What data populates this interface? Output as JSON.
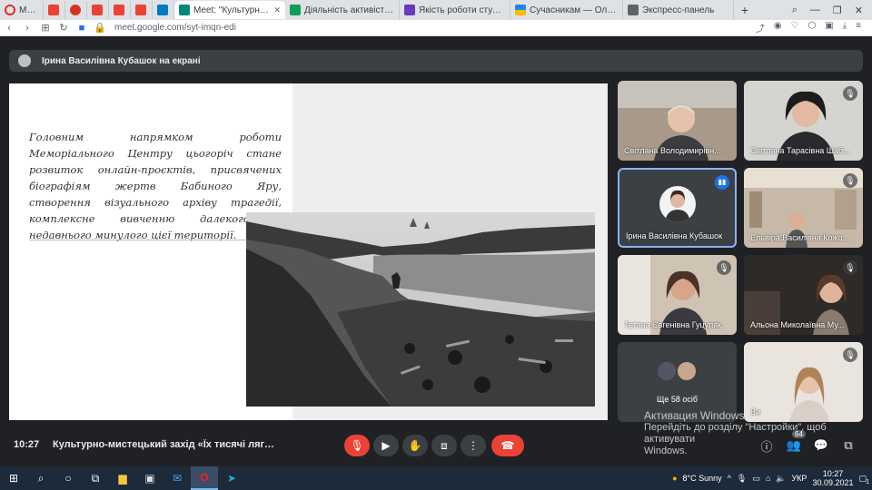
{
  "browser": {
    "tabs": [
      {
        "label": "Меню",
        "color": "#d93025",
        "active": false
      },
      {
        "label": "",
        "color": "#ea4335",
        "active": false
      },
      {
        "label": "",
        "color": "#d93025",
        "active": false
      },
      {
        "label": "",
        "color": "#ea4335",
        "active": false
      },
      {
        "label": "",
        "color": "#ea4335",
        "active": false
      },
      {
        "label": "",
        "color": "#ea4335",
        "active": false
      },
      {
        "label": "",
        "color": "#0079bf",
        "active": false
      },
      {
        "label": "Meet: \"Культурно-мистецьк",
        "color": "#00897b",
        "active": true
      },
      {
        "label": "Діяльність активістів 1 сем",
        "color": "#0f9d58",
        "active": false
      },
      {
        "label": "Якість роботи студкуратор",
        "color": "#673ab7",
        "active": false
      },
      {
        "label": "Сучасникам — Олена Телі",
        "color": "#fbbc04",
        "active": false
      },
      {
        "label": "Экспресс-панель",
        "color": "#5f6368",
        "active": false
      }
    ],
    "new_tab": "+",
    "url": "meet.google.com/syt-imqn-edi"
  },
  "meet": {
    "presenter_label": "Ірина Василівна Кубашок на екрані",
    "slide_text": "Головним напрямком роботи Меморіального Центру цьогоріч стане розвиток онлайн-проєктів, присвячених біографіям жертв Бабиного Яру, створення візуального архіву трагедії, комплексне вивченню далекого й недавнього минулого цієї території.",
    "participants": [
      {
        "name": "Світлана Володимирівн...",
        "muted": false
      },
      {
        "name": "Світлана Тарасівна Шаб...",
        "muted": true
      },
      {
        "name": "Ірина Василівна Кубашок",
        "muted": false,
        "speaking": true
      },
      {
        "name": "Ельвіра Василівна Кожо...",
        "muted": true
      },
      {
        "name": "Тетяна Євгенівна Гуцуляк",
        "muted": true
      },
      {
        "name": "Альона Миколаївна Му...",
        "muted": true
      },
      {
        "name": "Ще 58 осіб",
        "muted": false
      },
      {
        "name": "Ви",
        "muted": true
      }
    ],
    "time": "10:27",
    "meeting_title": "Культурно-мистецький захід «Їх тисячі лягло у Ба...",
    "people_count": "64"
  },
  "windows_watermark": {
    "title": "Активация Windows",
    "line1": "Перейдіть до розділу \"Настройки\", щоб активувати",
    "line2": "Windows."
  },
  "taskbar": {
    "weather": "8°C  Sunny",
    "lang": "УКР",
    "time": "10:27",
    "date": "30.09.2021",
    "notifications": "1"
  }
}
